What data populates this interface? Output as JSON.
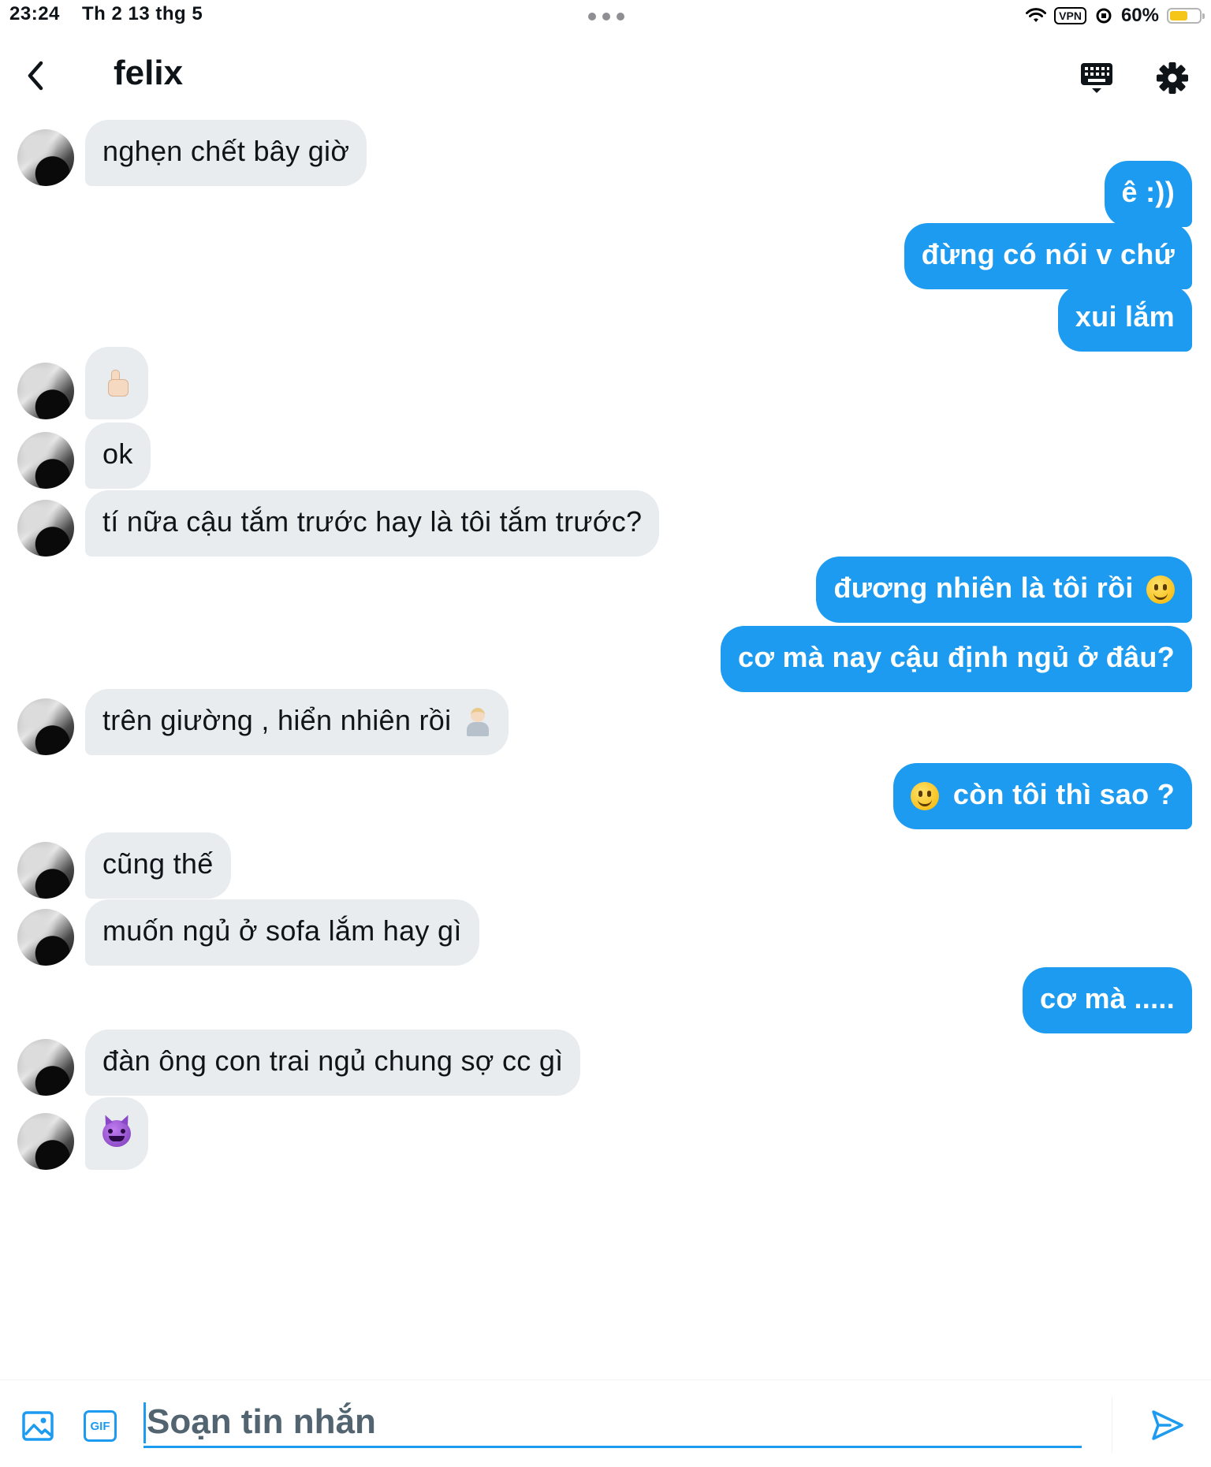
{
  "status_bar": {
    "time": "23:24",
    "date": "Th 2 13 thg 5",
    "vpn": "VPN",
    "battery": "60%",
    "battery_level": 0.6,
    "icons": [
      "wifi-icon",
      "vpn-badge",
      "orientation-lock-icon",
      "battery-icon"
    ]
  },
  "header": {
    "title": "felix",
    "icons": [
      "back-arrow-icon",
      "keyboard-icon",
      "gear-icon"
    ]
  },
  "messages": [
    {
      "dir": "in",
      "text": "nghẹn chết bây giờ"
    },
    {
      "dir": "out",
      "text": "ê :))"
    },
    {
      "dir": "out",
      "text": "đừng có nói v chứ"
    },
    {
      "dir": "out",
      "text": "xui lắm"
    },
    {
      "dir": "in",
      "text": "",
      "emoji": "thumbs-up"
    },
    {
      "dir": "in",
      "text": "ok"
    },
    {
      "dir": "in",
      "text": "tí nữa cậu tắm trước hay là tôi tắm trước?"
    },
    {
      "dir": "out",
      "text": "đương nhiên là tôi rồi",
      "emoji": "yum-face"
    },
    {
      "dir": "out",
      "text": "cơ mà nay cậu định ngủ ở đâu?"
    },
    {
      "dir": "in",
      "text": "trên giường , hiển nhiên rồi",
      "emoji": "person-tipping-hand"
    },
    {
      "dir": "out",
      "text": "còn tôi thì sao ?",
      "emoji": "smiley-face"
    },
    {
      "dir": "in",
      "text": "cũng thế"
    },
    {
      "dir": "in",
      "text": "muốn ngủ ở sofa lắm hay gì"
    },
    {
      "dir": "out",
      "text": "cơ mà ....."
    },
    {
      "dir": "in",
      "text": "đàn ông con trai ngủ chung sợ cc gì"
    },
    {
      "dir": "in",
      "text": "",
      "emoji": "smiling-devil"
    }
  ],
  "composer": {
    "placeholder": "Soạn tin nhắn",
    "value": "",
    "gif_label": "GIF",
    "icons": [
      "image-icon",
      "gif-icon",
      "send-icon"
    ]
  },
  "colors": {
    "accent": "#1d9bf0",
    "incoming_bubble": "#e8ecef",
    "text": "#0f1419"
  }
}
